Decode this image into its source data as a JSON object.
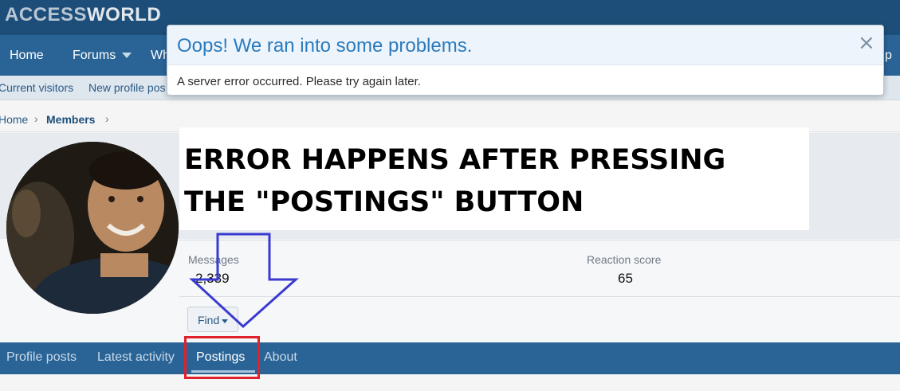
{
  "header": {
    "logo_a": "ACCESS",
    "logo_b": "WORLD"
  },
  "nav": {
    "home": "Home",
    "forums": "Forums",
    "whats_new_partial": "Wh",
    "help_partial": "p"
  },
  "sub_nav": {
    "current_visitors": "Current visitors",
    "new_profile_posts_partial": "New profile pos"
  },
  "breadcrumb": {
    "home": "Home",
    "members": "Members",
    "separator": "›"
  },
  "profile": {
    "messages_label": "Messages",
    "messages_value": "2,339",
    "reaction_label": "Reaction score",
    "reaction_value": "65",
    "find_label": "Find"
  },
  "tabs": {
    "profile_posts": "Profile posts",
    "latest_activity": "Latest activity",
    "postings": "Postings",
    "about": "About"
  },
  "modal": {
    "title": "Oops! We ran into some problems.",
    "close_glyph": "×",
    "message": "A server error occurred. Please try again later."
  },
  "annotation": {
    "line1": "ERROR HAPPENS AFTER PRESSING",
    "line2": "THE \"POSTINGS\" BUTTON"
  },
  "colors": {
    "brand": "#1d4e7a",
    "nav": "#2a6496",
    "highlight": "#e0202a",
    "arrow": "#3a3ad0"
  },
  "icons": {
    "close": "close-icon",
    "find_caret": "chevron-down-icon",
    "arrow": "down-arrow-annotation-icon"
  }
}
